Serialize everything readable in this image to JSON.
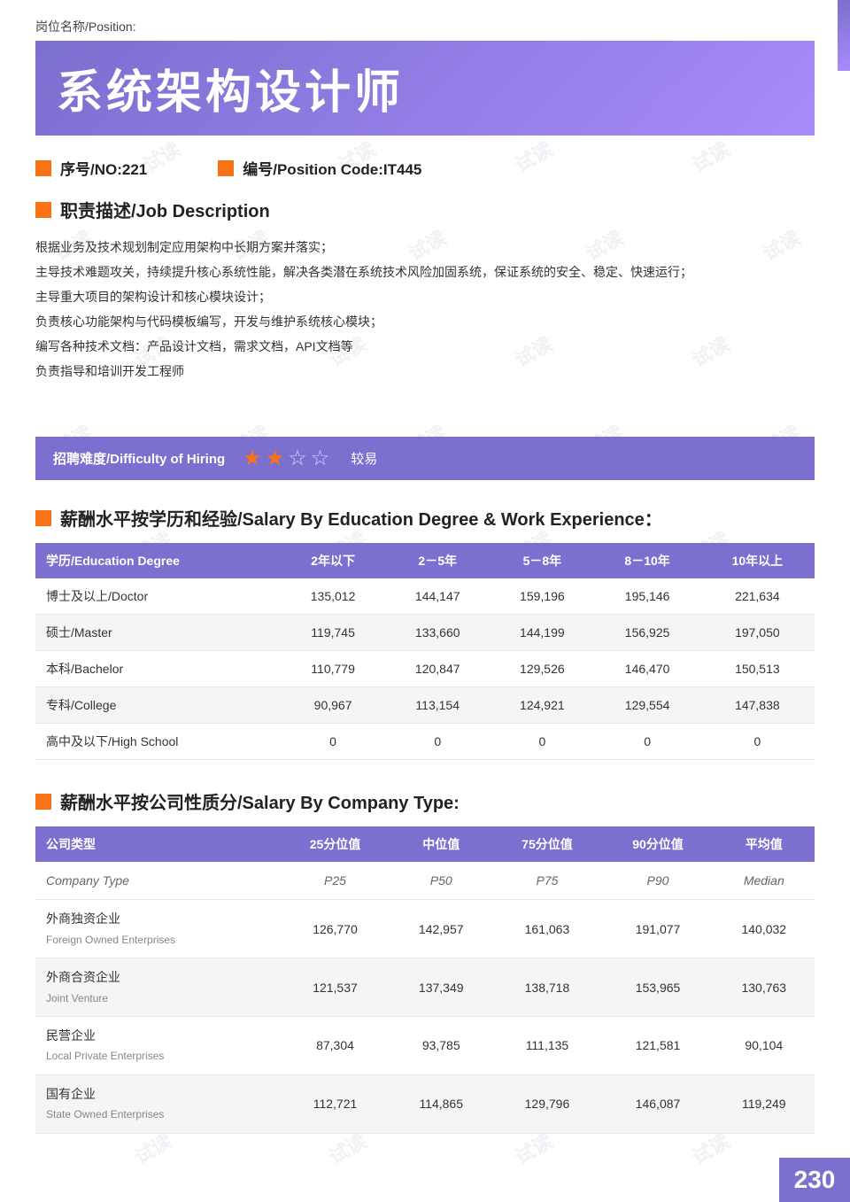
{
  "page": {
    "position_label": "岗位名称/Position:",
    "title_chinese": "系统架构设计师",
    "no_label": "序号/NO:221",
    "code_label": "编号/Position Code:IT445",
    "job_desc_header": "职责描述/Job Description",
    "job_description_lines": [
      "根据业务及技术规划制定应用架构中长期方案并落实；",
      "主导技术难题攻关，持续提升核心系统性能，解决各类潜在系统技术风险加固系统，保证系统的安全、稳定、快速运行；",
      "主导重大项目的架构设计和核心模块设计；",
      "负责核心功能架构与代码模板编写，开发与维护系统核心模块；",
      "编写各种技术文档：产品设计文档，需求文档，API文档等",
      "负责指导和培训开发工程师"
    ],
    "difficulty_label": "招聘难度/Difficulty of Hiring",
    "difficulty_rating": "较易",
    "stars_filled": 2,
    "stars_total": 4,
    "salary_edu_header": "薪酬水平按学历和经验/Salary By Education Degree & Work Experience：",
    "salary_edu_columns": [
      "学历/Education Degree",
      "2年以下",
      "2－5年",
      "5－8年",
      "8－10年",
      "10年以上"
    ],
    "salary_edu_rows": [
      {
        "edu": "博士及以上/Doctor",
        "y2": "135,012",
        "y25": "144,147",
        "y58": "159,196",
        "y810": "195,146",
        "y10p": "221,634"
      },
      {
        "edu": "硕士/Master",
        "y2": "119,745",
        "y25": "133,660",
        "y58": "144,199",
        "y810": "156,925",
        "y10p": "197,050"
      },
      {
        "edu": "本科/Bachelor",
        "y2": "110,779",
        "y25": "120,847",
        "y58": "129,526",
        "y810": "146,470",
        "y10p": "150,513"
      },
      {
        "edu": "专科/College",
        "y2": "90,967",
        "y25": "113,154",
        "y58": "124,921",
        "y810": "129,554",
        "y10p": "147,838"
      },
      {
        "edu": "高中及以下/High School",
        "y2": "0",
        "y25": "0",
        "y58": "0",
        "y810": "0",
        "y10p": "0"
      }
    ],
    "salary_company_header": "薪酬水平按公司性质分/Salary By Company Type:",
    "salary_company_columns": [
      "公司类型",
      "25分位值",
      "中位值",
      "75分位值",
      "90分位值",
      "平均值"
    ],
    "salary_company_subheader": [
      "Company Type",
      "P25",
      "P50",
      "P75",
      "P90",
      "Median"
    ],
    "salary_company_rows": [
      {
        "type_cn": "外商独资企业",
        "type_en": "Foreign Owned Enterprises",
        "p25": "126,770",
        "p50": "142,957",
        "p75": "161,063",
        "p90": "191,077",
        "median": "140,032"
      },
      {
        "type_cn": "外商合资企业",
        "type_en": "Joint Venture",
        "p25": "121,537",
        "p50": "137,349",
        "p75": "138,718",
        "p90": "153,965",
        "median": "130,763"
      },
      {
        "type_cn": "民营企业",
        "type_en": "Local Private Enterprises",
        "p25": "87,304",
        "p50": "93,785",
        "p75": "111,135",
        "p90": "121,581",
        "median": "90,104"
      },
      {
        "type_cn": "国有企业",
        "type_en": "State Owned Enterprises",
        "p25": "112,721",
        "p50": "114,865",
        "p75": "129,796",
        "p90": "146,087",
        "median": "119,249"
      }
    ],
    "page_number": "230",
    "watermarks": [
      "试读",
      "试读",
      "试读",
      "试读",
      "试读",
      "试读",
      "试读",
      "试读",
      "试读",
      "试读",
      "试读",
      "试读",
      "试读",
      "试读",
      "试读",
      "试读",
      "试读",
      "试读",
      "试读",
      "试读",
      "试读",
      "试读",
      "试读",
      "试读"
    ]
  }
}
